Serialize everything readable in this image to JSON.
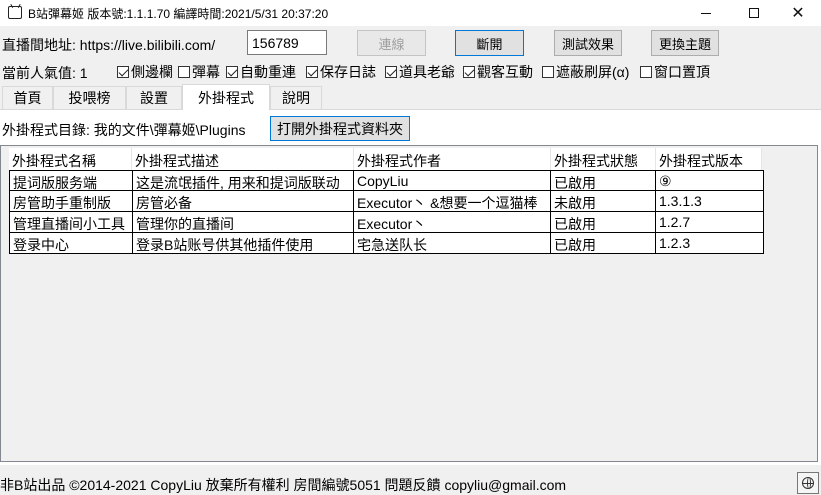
{
  "window": {
    "title": "B站彈幕姬 版本號:1.1.1.70 編譯時間:2021/5/31 20:37:20"
  },
  "connection": {
    "room_label": "直播間地址: https://live.bilibili.com/",
    "room_id": "156789",
    "connect_label": "連線",
    "disconnect_label": "斷開",
    "test_label": "測試效果",
    "theme_label": "更換主題"
  },
  "status": {
    "popularity": "當前人氣值: 1"
  },
  "options": [
    {
      "label": "側邊欄",
      "checked": true
    },
    {
      "label": "彈幕",
      "checked": false
    },
    {
      "label": "自動重連",
      "checked": true
    },
    {
      "label": "保存日誌",
      "checked": true
    },
    {
      "label": "道具老爺",
      "checked": true
    },
    {
      "label": "觀客互動",
      "checked": true
    },
    {
      "label": "遮蔽刷屏(α)",
      "checked": false
    },
    {
      "label": "窗口置頂",
      "checked": false
    }
  ],
  "tabs": [
    {
      "label": "首頁"
    },
    {
      "label": "投喂榜"
    },
    {
      "label": "設置"
    },
    {
      "label": "外掛程式",
      "active": true
    },
    {
      "label": "說明"
    }
  ],
  "plugins": {
    "dir_label": "外掛程式目錄: 我的文件\\彈幕姬\\Plugins",
    "open_button": "打開外掛程式資料夾",
    "columns": [
      "外掛程式名稱",
      "外掛程式描述",
      "外掛程式作者",
      "外掛程式狀態",
      "外掛程式版本"
    ],
    "rows": [
      [
        "提词版服务端",
        "这是流氓插件, 用来和提词版联动",
        "CopyLiu",
        "已啟用",
        "⑨"
      ],
      [
        "房管助手重制版",
        "房管必备",
        "Executor丶 &想要一个逗猫棒",
        "未啟用",
        "1.3.1.3"
      ],
      [
        "管理直播间小工具",
        "管理你的直播间",
        "Executor丶",
        "已啟用",
        "1.2.7"
      ],
      [
        "登录中心",
        "登录B站账号供其他插件使用",
        "宅急送队长",
        "已啟用",
        "1.2.3"
      ]
    ]
  },
  "footer": {
    "text": "非B站出品 ©2014-2021 CopyLiu 放棄所有權利 房間編號5051 問題反饋 copyliu@gmail.com",
    "icon": "globe-icon"
  },
  "colors": {
    "accent": "#0078d7",
    "sort_indicator": "#f0a04a"
  }
}
